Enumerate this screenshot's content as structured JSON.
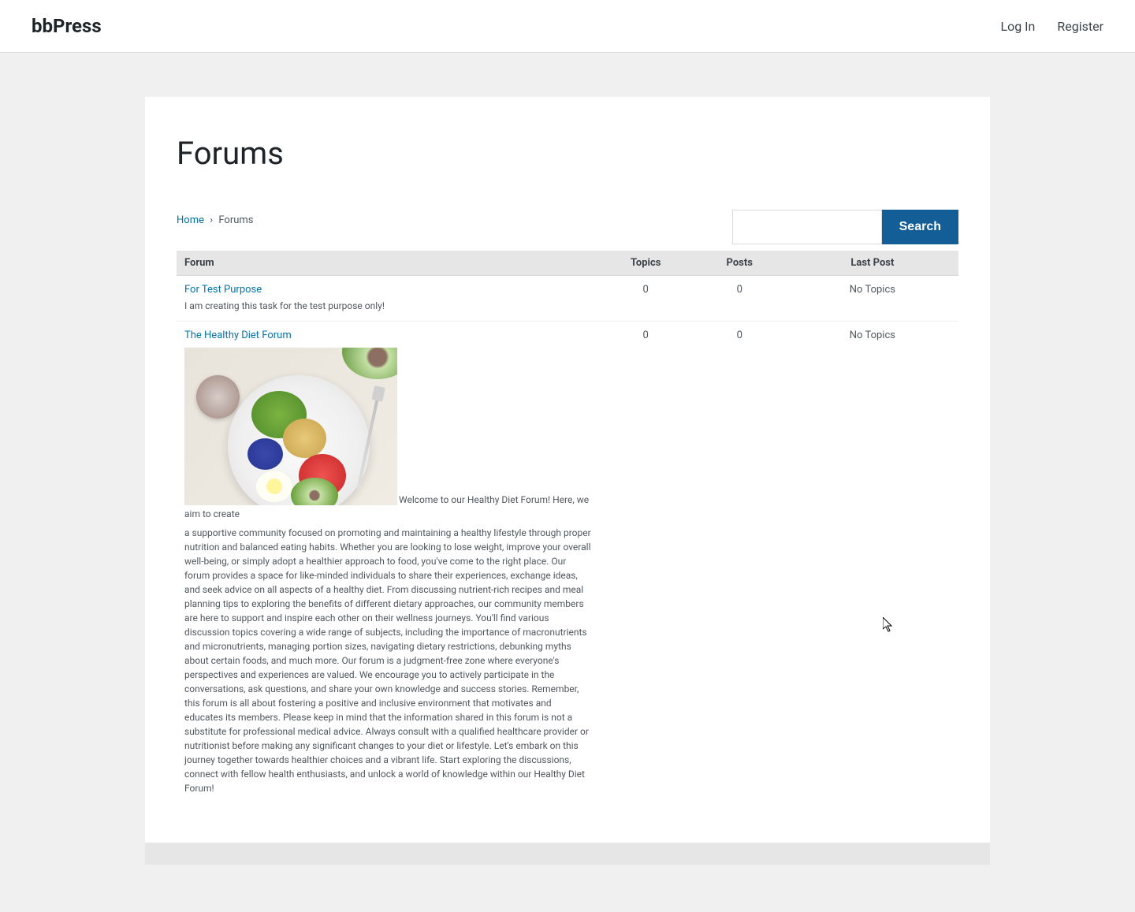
{
  "site": {
    "title": "bbPress"
  },
  "header_nav": {
    "login": "Log In",
    "register": "Register"
  },
  "page": {
    "title": "Forums"
  },
  "breadcrumb": {
    "home": "Home",
    "sep": "›",
    "current": "Forums"
  },
  "search": {
    "button": "Search",
    "placeholder": ""
  },
  "table_headers": {
    "forum": "Forum",
    "topics": "Topics",
    "posts": "Posts",
    "last_post": "Last Post"
  },
  "forums": [
    {
      "title": "For Test Purpose",
      "description": "I am creating this task for the test purpose only!",
      "topics": "0",
      "posts": "0",
      "last_post": "No Topics"
    },
    {
      "title": "The Healthy Diet Forum",
      "desc_part1": "Welcome to our Healthy Diet Forum! Here, we aim to create",
      "desc_part2": "a supportive community focused on promoting and maintaining a healthy lifestyle through proper nutrition and balanced eating habits. Whether you are looking to lose weight, improve your overall well-being, or simply adopt a healthier approach to food, you've come to the right place. Our forum provides a space for like-minded individuals to share their experiences, exchange ideas, and seek advice on all aspects of a healthy diet. From discussing nutrient-rich recipes and meal planning tips to exploring the benefits of different dietary approaches, our community members are here to support and inspire each other on their wellness journeys. You'll find various discussion topics covering a wide range of subjects, including the importance of macronutrients and micronutrients, managing portion sizes, navigating dietary restrictions, debunking myths about certain foods, and much more. Our forum is a judgment-free zone where everyone's perspectives and experiences are valued. We encourage you to actively participate in the conversations, ask questions, and share your own knowledge and success stories. Remember, this forum is all about fostering a positive and inclusive environment that motivates and educates its members. Please keep in mind that the information shared in this forum is not a substitute for professional medical advice. Always consult with a qualified healthcare provider or nutritionist before making any significant changes to your diet or lifestyle. Let's embark on this journey together towards healthier choices and a vibrant life. Start exploring the discussions, connect with fellow health enthusiasts, and unlock a world of knowledge within our Healthy Diet Forum!",
      "topics": "0",
      "posts": "0",
      "last_post": "No Topics"
    }
  ]
}
